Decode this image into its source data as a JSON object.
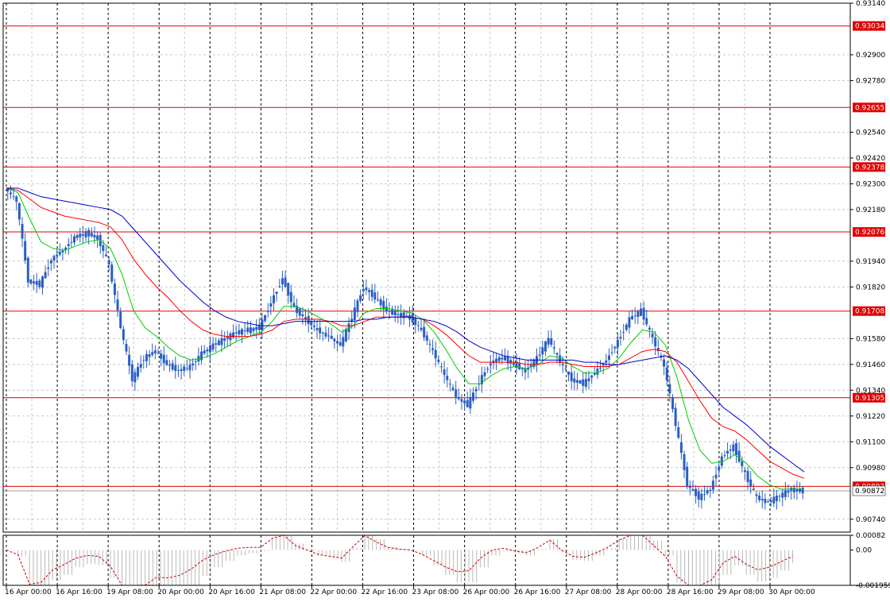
{
  "chart_data": {
    "type": "candlestick",
    "price_axis": {
      "range": [
        0.9068,
        0.9314
      ],
      "tick_labels": [
        "0.93140",
        "0.92900",
        "0.92780",
        "0.92540",
        "0.92420",
        "0.92300",
        "0.92180",
        "0.91940",
        "0.91820",
        "0.91580",
        "0.91460",
        "0.91340",
        "0.91220",
        "0.91100",
        "0.90980",
        "0.90740"
      ]
    },
    "time_axis": {
      "labels": [
        "16 Apr 00:00",
        "16 Apr 16:00",
        "19 Apr 08:00",
        "20 Apr 00:00",
        "20 Apr 16:00",
        "21 Apr 08:00",
        "22 Apr 00:00",
        "22 Apr 16:00",
        "23 Apr 08:00",
        "26 Apr 00:00",
        "26 Apr 16:00",
        "27 Apr 08:00",
        "28 Apr 00:00",
        "28 Apr 16:00",
        "29 Apr 08:00",
        "30 Apr 00:00"
      ]
    },
    "levels": [
      "0.93034",
      "0.92655",
      "0.92378",
      "0.92076",
      "0.91708",
      "0.91305",
      "0.90893"
    ],
    "current_price": "0.90872",
    "close_series": [
      0.9228,
      0.9222,
      0.9185,
      0.9183,
      0.9195,
      0.9199,
      0.9205,
      0.9207,
      0.9205,
      0.9192,
      0.9163,
      0.9139,
      0.9149,
      0.9152,
      0.9146,
      0.9143,
      0.9145,
      0.9151,
      0.9155,
      0.9158,
      0.9161,
      0.9162,
      0.9163,
      0.9175,
      0.9186,
      0.9172,
      0.9167,
      0.9162,
      0.9159,
      0.9155,
      0.9168,
      0.9182,
      0.9177,
      0.9171,
      0.9169,
      0.9168,
      0.9162,
      0.9152,
      0.9141,
      0.9131,
      0.9127,
      0.9138,
      0.9147,
      0.9149,
      0.9146,
      0.9143,
      0.9149,
      0.9158,
      0.9147,
      0.9139,
      0.9137,
      0.9142,
      0.9148,
      0.9157,
      0.9167,
      0.9171,
      0.9158,
      0.9145,
      0.9118,
      0.909,
      0.9084,
      0.9088,
      0.9103,
      0.9108,
      0.9095,
      0.9084,
      0.9082,
      0.9085,
      0.9088,
      0.9087
    ],
    "moving_averages": [
      {
        "color": "#00cc00",
        "values": [
          0.9228,
          0.9226,
          0.9214,
          0.9203,
          0.92,
          0.9199,
          0.9201,
          0.9203,
          0.9204,
          0.92,
          0.9188,
          0.9171,
          0.9163,
          0.9159,
          0.9154,
          0.915,
          0.9148,
          0.9149,
          0.9151,
          0.9154,
          0.9157,
          0.9159,
          0.9161,
          0.9166,
          0.9173,
          0.9173,
          0.9171,
          0.9168,
          0.9165,
          0.9161,
          0.9164,
          0.917,
          0.9172,
          0.9172,
          0.9171,
          0.917,
          0.9167,
          0.9161,
          0.9153,
          0.9144,
          0.9137,
          0.9137,
          0.9141,
          0.9144,
          0.9145,
          0.9144,
          0.9146,
          0.915,
          0.9149,
          0.9145,
          0.9142,
          0.9142,
          0.9144,
          0.9149,
          0.9156,
          0.9162,
          0.9161,
          0.9155,
          0.914,
          0.912,
          0.9106,
          0.91,
          0.9101,
          0.9104,
          0.91,
          0.9094,
          0.909,
          0.9088,
          0.9088,
          0.9088
        ]
      },
      {
        "color": "#ff0000",
        "values": [
          0.9228,
          0.9227,
          0.9223,
          0.9219,
          0.9217,
          0.9215,
          0.9214,
          0.9213,
          0.9212,
          0.921,
          0.9204,
          0.9195,
          0.9188,
          0.9182,
          0.9177,
          0.9171,
          0.9166,
          0.9162,
          0.916,
          0.9159,
          0.9159,
          0.9159,
          0.916,
          0.9162,
          0.9166,
          0.9167,
          0.9167,
          0.9167,
          0.9166,
          0.9164,
          0.9164,
          0.9166,
          0.9168,
          0.9168,
          0.9168,
          0.9168,
          0.9167,
          0.9164,
          0.916,
          0.9155,
          0.915,
          0.9147,
          0.9147,
          0.9147,
          0.9147,
          0.9146,
          0.9146,
          0.9147,
          0.9147,
          0.9146,
          0.9145,
          0.9145,
          0.9145,
          0.9146,
          0.9149,
          0.9152,
          0.9153,
          0.9152,
          0.9147,
          0.9138,
          0.9129,
          0.9121,
          0.9117,
          0.9115,
          0.9111,
          0.9106,
          0.9101,
          0.9098,
          0.9095,
          0.9093
        ]
      },
      {
        "color": "#0000cc",
        "values": [
          0.9228,
          0.9228,
          0.9226,
          0.9224,
          0.9223,
          0.9222,
          0.9221,
          0.922,
          0.9219,
          0.9218,
          0.9215,
          0.9209,
          0.9203,
          0.9197,
          0.9191,
          0.9185,
          0.918,
          0.9175,
          0.9171,
          0.9168,
          0.9166,
          0.9165,
          0.9164,
          0.9164,
          0.9165,
          0.9166,
          0.9166,
          0.9166,
          0.9166,
          0.9166,
          0.9166,
          0.9167,
          0.9167,
          0.9168,
          0.9168,
          0.9168,
          0.9167,
          0.9166,
          0.9164,
          0.9161,
          0.9157,
          0.9154,
          0.9152,
          0.915,
          0.9149,
          0.9148,
          0.9148,
          0.9148,
          0.9148,
          0.9148,
          0.9147,
          0.9147,
          0.9146,
          0.9146,
          0.9147,
          0.9148,
          0.9149,
          0.915,
          0.9148,
          0.9144,
          0.9138,
          0.9132,
          0.9126,
          0.9122,
          0.9118,
          0.9113,
          0.9108,
          0.9104,
          0.91,
          0.9096
        ]
      }
    ],
    "oscillator": {
      "tick_labels": [
        "0.00082",
        "0.00",
        "-0.001959"
      ],
      "range": [
        -0.001959,
        0.00082
      ],
      "signal_color": "#cc0000"
    }
  }
}
